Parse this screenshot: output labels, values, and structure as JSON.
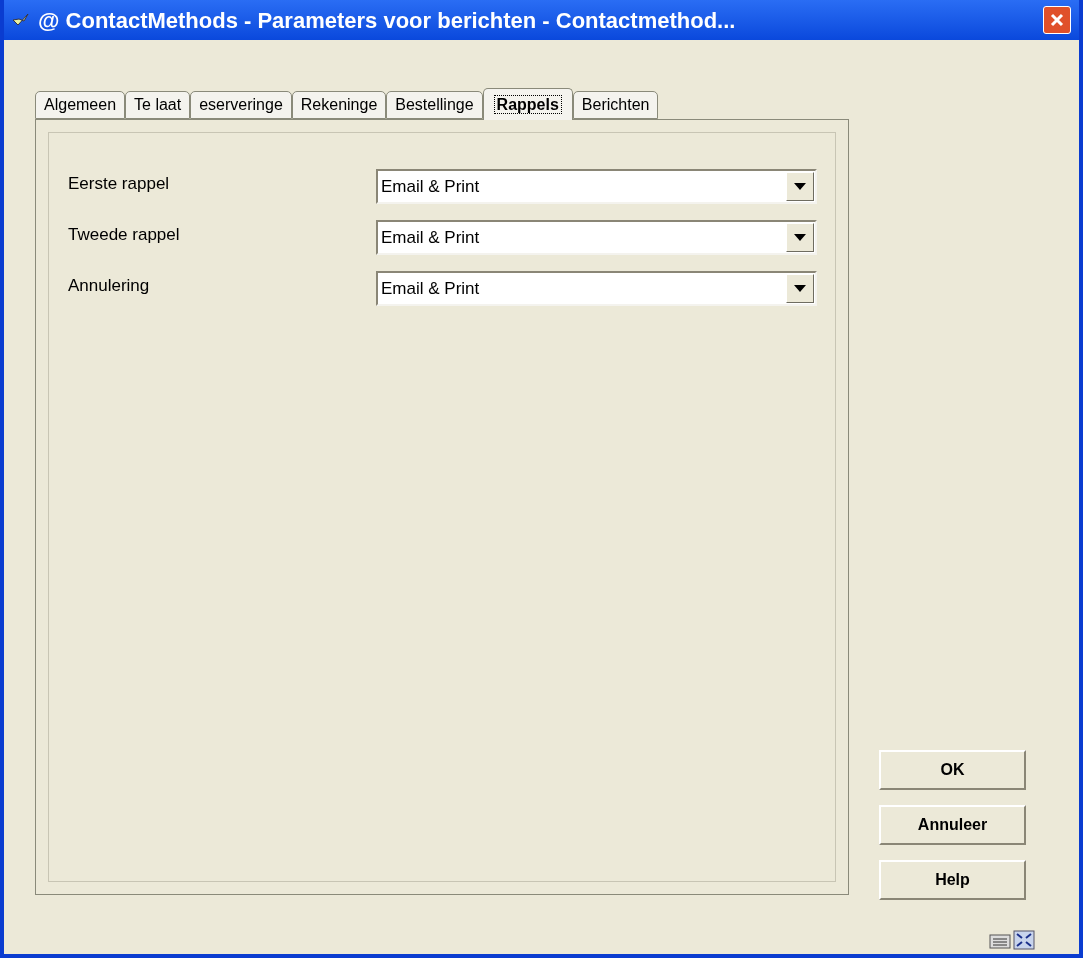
{
  "window": {
    "title": "@ ContactMethods - Parameters voor berichten - Contactmethod..."
  },
  "tabs": [
    {
      "label": "Algemeen",
      "selected": false
    },
    {
      "label": "Te laat",
      "selected": false
    },
    {
      "label": "eserveringe",
      "selected": false
    },
    {
      "label": "Rekeninge",
      "selected": false
    },
    {
      "label": "Bestellinge",
      "selected": false
    },
    {
      "label": "Rappels",
      "selected": true
    },
    {
      "label": "Berichten",
      "selected": false
    }
  ],
  "fields": [
    {
      "label": "Eerste rappel",
      "value": "Email & Print"
    },
    {
      "label": "Tweede rappel",
      "value": "Email & Print"
    },
    {
      "label": "Annulering",
      "value": "Email & Print"
    }
  ],
  "buttons": [
    {
      "label": "OK"
    },
    {
      "label": "Annuleer"
    },
    {
      "label": "Help"
    }
  ]
}
